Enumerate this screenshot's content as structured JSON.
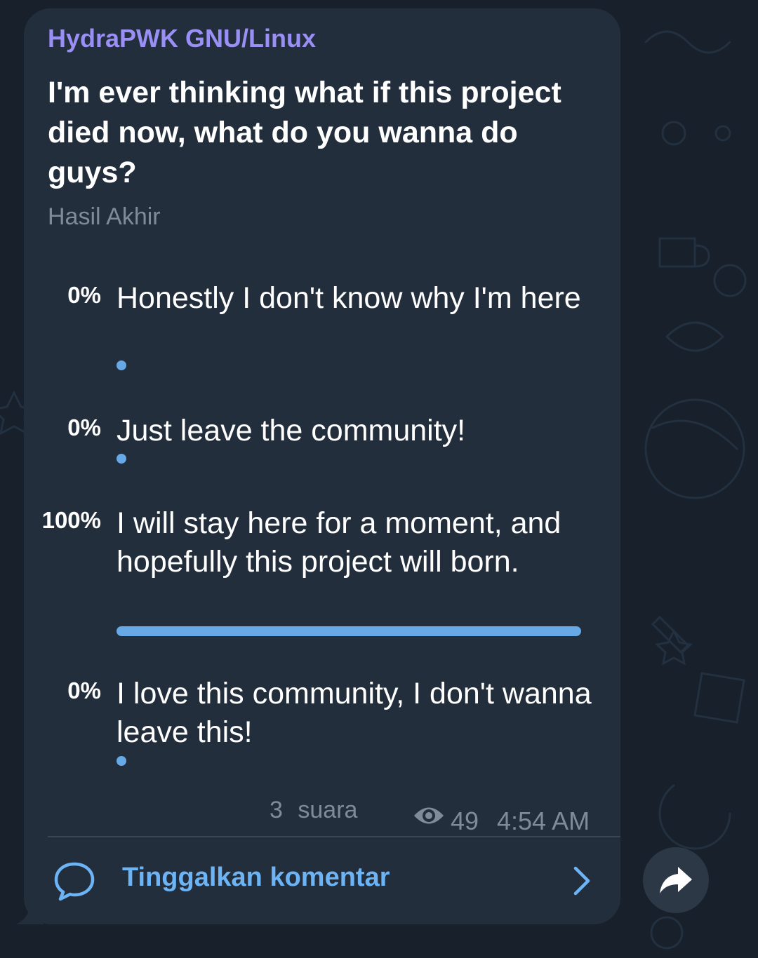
{
  "channel": {
    "name": "HydraPWK GNU/Linux"
  },
  "poll": {
    "question": "I'm ever thinking what if this project died now, what do you wanna do guys?",
    "type_label": "Hasil Akhir",
    "options": [
      {
        "percent": "0%",
        "text": "Honestly I don't know why I'm here",
        "fraction": 0
      },
      {
        "percent": "0%",
        "text": "Just leave the community!",
        "fraction": 0
      },
      {
        "percent": "100%",
        "text": "I will stay here for a moment, and hopefully this project will born.",
        "fraction": 1
      },
      {
        "percent": "0%",
        "text": "I love this community, I don't wanna leave this!",
        "fraction": 0
      }
    ],
    "votes_count": "3",
    "votes_label": "suara"
  },
  "meta": {
    "views": "49",
    "time": "4:54 AM",
    "views_icon": "eye-icon"
  },
  "comments": {
    "label": "Tinggalkan komentar",
    "icon": "speech-bubble-icon",
    "chevron": "chevron-right-icon"
  },
  "share": {
    "icon": "share-arrow-icon"
  },
  "colors": {
    "background": "#17202b",
    "bubble": "#232e3c",
    "author": "#9a8ff5",
    "accent": "#67a9e6",
    "link": "#6cb4f5",
    "muted": "#7f8b98"
  }
}
